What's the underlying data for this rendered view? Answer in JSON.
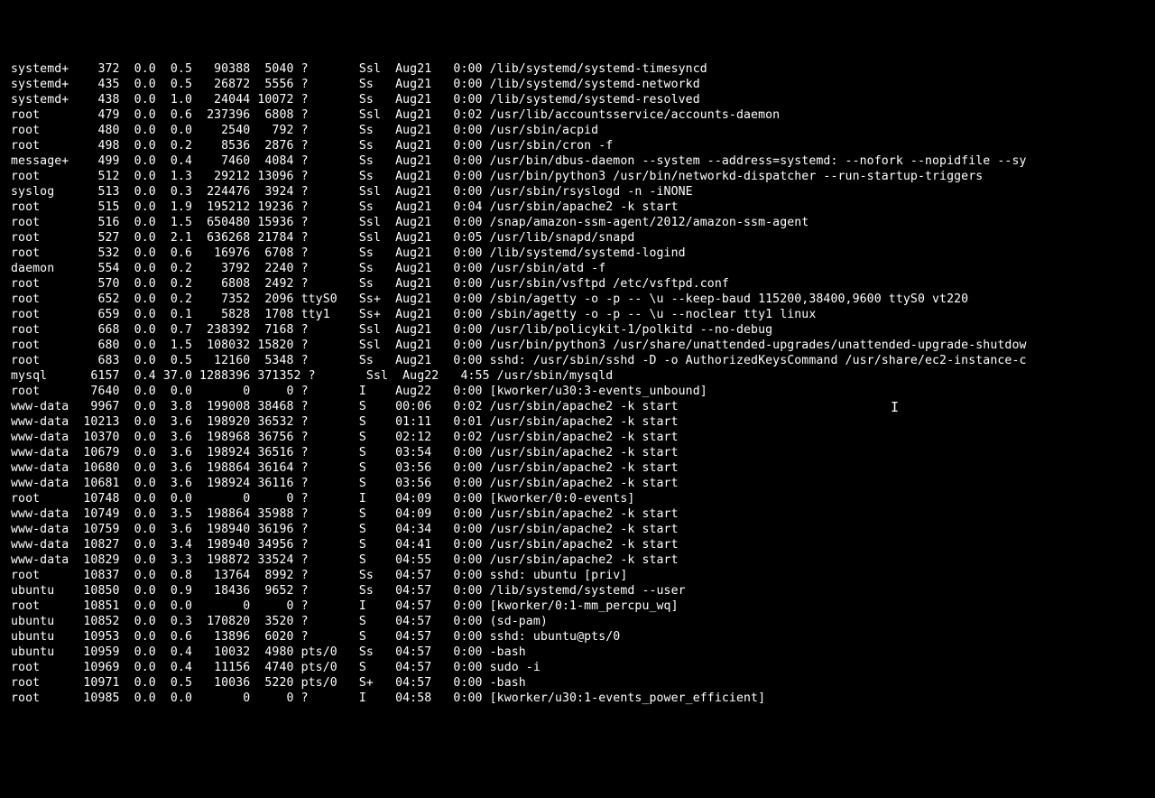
{
  "cursor_glyph": "I",
  "cols_pad": {
    "user": 9,
    "pid": 8,
    "cpu": 5,
    "mem": 5,
    "vsz": 7,
    "rss": 6,
    "tty": 6,
    "stat": 5,
    "start": 7,
    "time": 5
  },
  "rows": [
    {
      "user": "systemd+",
      "pid": "372",
      "cpu": "0.0",
      "mem": "0.5",
      "vsz": "90388",
      "rss": "5040",
      "tty": "?",
      "stat": "Ssl",
      "start": "Aug21",
      "time": "0:00",
      "cmd": "/lib/systemd/systemd-timesyncd"
    },
    {
      "user": "systemd+",
      "pid": "435",
      "cpu": "0.0",
      "mem": "0.5",
      "vsz": "26872",
      "rss": "5556",
      "tty": "?",
      "stat": "Ss",
      "start": "Aug21",
      "time": "0:00",
      "cmd": "/lib/systemd/systemd-networkd"
    },
    {
      "user": "systemd+",
      "pid": "438",
      "cpu": "0.0",
      "mem": "1.0",
      "vsz": "24044",
      "rss": "10072",
      "tty": "?",
      "stat": "Ss",
      "start": "Aug21",
      "time": "0:00",
      "cmd": "/lib/systemd/systemd-resolved"
    },
    {
      "user": "root",
      "pid": "479",
      "cpu": "0.0",
      "mem": "0.6",
      "vsz": "237396",
      "rss": "6808",
      "tty": "?",
      "stat": "Ssl",
      "start": "Aug21",
      "time": "0:02",
      "cmd": "/usr/lib/accountsservice/accounts-daemon"
    },
    {
      "user": "root",
      "pid": "480",
      "cpu": "0.0",
      "mem": "0.0",
      "vsz": "2540",
      "rss": "792",
      "tty": "?",
      "stat": "Ss",
      "start": "Aug21",
      "time": "0:00",
      "cmd": "/usr/sbin/acpid"
    },
    {
      "user": "root",
      "pid": "498",
      "cpu": "0.0",
      "mem": "0.2",
      "vsz": "8536",
      "rss": "2876",
      "tty": "?",
      "stat": "Ss",
      "start": "Aug21",
      "time": "0:00",
      "cmd": "/usr/sbin/cron -f"
    },
    {
      "user": "message+",
      "pid": "499",
      "cpu": "0.0",
      "mem": "0.4",
      "vsz": "7460",
      "rss": "4084",
      "tty": "?",
      "stat": "Ss",
      "start": "Aug21",
      "time": "0:00",
      "cmd": "/usr/bin/dbus-daemon --system --address=systemd: --nofork --nopidfile --sy"
    },
    {
      "user": "root",
      "pid": "512",
      "cpu": "0.0",
      "mem": "1.3",
      "vsz": "29212",
      "rss": "13096",
      "tty": "?",
      "stat": "Ss",
      "start": "Aug21",
      "time": "0:00",
      "cmd": "/usr/bin/python3 /usr/bin/networkd-dispatcher --run-startup-triggers"
    },
    {
      "user": "syslog",
      "pid": "513",
      "cpu": "0.0",
      "mem": "0.3",
      "vsz": "224476",
      "rss": "3924",
      "tty": "?",
      "stat": "Ssl",
      "start": "Aug21",
      "time": "0:00",
      "cmd": "/usr/sbin/rsyslogd -n -iNONE"
    },
    {
      "user": "root",
      "pid": "515",
      "cpu": "0.0",
      "mem": "1.9",
      "vsz": "195212",
      "rss": "19236",
      "tty": "?",
      "stat": "Ss",
      "start": "Aug21",
      "time": "0:04",
      "cmd": "/usr/sbin/apache2 -k start"
    },
    {
      "user": "root",
      "pid": "516",
      "cpu": "0.0",
      "mem": "1.5",
      "vsz": "650480",
      "rss": "15936",
      "tty": "?",
      "stat": "Ssl",
      "start": "Aug21",
      "time": "0:00",
      "cmd": "/snap/amazon-ssm-agent/2012/amazon-ssm-agent"
    },
    {
      "user": "root",
      "pid": "527",
      "cpu": "0.0",
      "mem": "2.1",
      "vsz": "636268",
      "rss": "21784",
      "tty": "?",
      "stat": "Ssl",
      "start": "Aug21",
      "time": "0:05",
      "cmd": "/usr/lib/snapd/snapd"
    },
    {
      "user": "root",
      "pid": "532",
      "cpu": "0.0",
      "mem": "0.6",
      "vsz": "16976",
      "rss": "6708",
      "tty": "?",
      "stat": "Ss",
      "start": "Aug21",
      "time": "0:00",
      "cmd": "/lib/systemd/systemd-logind"
    },
    {
      "user": "daemon",
      "pid": "554",
      "cpu": "0.0",
      "mem": "0.2",
      "vsz": "3792",
      "rss": "2240",
      "tty": "?",
      "stat": "Ss",
      "start": "Aug21",
      "time": "0:00",
      "cmd": "/usr/sbin/atd -f"
    },
    {
      "user": "root",
      "pid": "570",
      "cpu": "0.0",
      "mem": "0.2",
      "vsz": "6808",
      "rss": "2492",
      "tty": "?",
      "stat": "Ss",
      "start": "Aug21",
      "time": "0:00",
      "cmd": "/usr/sbin/vsftpd /etc/vsftpd.conf"
    },
    {
      "user": "root",
      "pid": "652",
      "cpu": "0.0",
      "mem": "0.2",
      "vsz": "7352",
      "rss": "2096",
      "tty": "ttyS0",
      "stat": "Ss+",
      "start": "Aug21",
      "time": "0:00",
      "cmd": "/sbin/agetty -o -p -- \\u --keep-baud 115200,38400,9600 ttyS0 vt220"
    },
    {
      "user": "root",
      "pid": "659",
      "cpu": "0.0",
      "mem": "0.1",
      "vsz": "5828",
      "rss": "1708",
      "tty": "tty1",
      "stat": "Ss+",
      "start": "Aug21",
      "time": "0:00",
      "cmd": "/sbin/agetty -o -p -- \\u --noclear tty1 linux"
    },
    {
      "user": "root",
      "pid": "668",
      "cpu": "0.0",
      "mem": "0.7",
      "vsz": "238392",
      "rss": "7168",
      "tty": "?",
      "stat": "Ssl",
      "start": "Aug21",
      "time": "0:00",
      "cmd": "/usr/lib/policykit-1/polkitd --no-debug"
    },
    {
      "user": "root",
      "pid": "680",
      "cpu": "0.0",
      "mem": "1.5",
      "vsz": "108032",
      "rss": "15820",
      "tty": "?",
      "stat": "Ssl",
      "start": "Aug21",
      "time": "0:00",
      "cmd": "/usr/bin/python3 /usr/share/unattended-upgrades/unattended-upgrade-shutdow"
    },
    {
      "user": "root",
      "pid": "683",
      "cpu": "0.0",
      "mem": "0.5",
      "vsz": "12160",
      "rss": "5348",
      "tty": "?",
      "stat": "Ss",
      "start": "Aug21",
      "time": "0:00",
      "cmd": "sshd: /usr/sbin/sshd -D -o AuthorizedKeysCommand /usr/share/ec2-instance-c"
    },
    {
      "user": "mysql",
      "pid": "6157",
      "cpu": "0.4",
      "mem": "37.0",
      "vsz": "1288396",
      "rss": "371352",
      "tty": "?",
      "stat": "Ssl",
      "start": "Aug22",
      "time": "4:55",
      "cmd": "/usr/sbin/mysqld"
    },
    {
      "user": "root",
      "pid": "7640",
      "cpu": "0.0",
      "mem": "0.0",
      "vsz": "0",
      "rss": "0",
      "tty": "?",
      "stat": "I",
      "start": "Aug22",
      "time": "0:00",
      "cmd": "[kworker/u30:3-events_unbound]"
    },
    {
      "user": "www-data",
      "pid": "9967",
      "cpu": "0.0",
      "mem": "3.8",
      "vsz": "199008",
      "rss": "38468",
      "tty": "?",
      "stat": "S",
      "start": "00:06",
      "time": "0:02",
      "cmd": "/usr/sbin/apache2 -k start"
    },
    {
      "user": "www-data",
      "pid": "10213",
      "cpu": "0.0",
      "mem": "3.6",
      "vsz": "198920",
      "rss": "36532",
      "tty": "?",
      "stat": "S",
      "start": "01:11",
      "time": "0:01",
      "cmd": "/usr/sbin/apache2 -k start"
    },
    {
      "user": "www-data",
      "pid": "10370",
      "cpu": "0.0",
      "mem": "3.6",
      "vsz": "198968",
      "rss": "36756",
      "tty": "?",
      "stat": "S",
      "start": "02:12",
      "time": "0:02",
      "cmd": "/usr/sbin/apache2 -k start"
    },
    {
      "user": "www-data",
      "pid": "10679",
      "cpu": "0.0",
      "mem": "3.6",
      "vsz": "198924",
      "rss": "36516",
      "tty": "?",
      "stat": "S",
      "start": "03:54",
      "time": "0:00",
      "cmd": "/usr/sbin/apache2 -k start"
    },
    {
      "user": "www-data",
      "pid": "10680",
      "cpu": "0.0",
      "mem": "3.6",
      "vsz": "198864",
      "rss": "36164",
      "tty": "?",
      "stat": "S",
      "start": "03:56",
      "time": "0:00",
      "cmd": "/usr/sbin/apache2 -k start"
    },
    {
      "user": "www-data",
      "pid": "10681",
      "cpu": "0.0",
      "mem": "3.6",
      "vsz": "198924",
      "rss": "36116",
      "tty": "?",
      "stat": "S",
      "start": "03:56",
      "time": "0:00",
      "cmd": "/usr/sbin/apache2 -k start"
    },
    {
      "user": "root",
      "pid": "10748",
      "cpu": "0.0",
      "mem": "0.0",
      "vsz": "0",
      "rss": "0",
      "tty": "?",
      "stat": "I",
      "start": "04:09",
      "time": "0:00",
      "cmd": "[kworker/0:0-events]"
    },
    {
      "user": "www-data",
      "pid": "10749",
      "cpu": "0.0",
      "mem": "3.5",
      "vsz": "198864",
      "rss": "35988",
      "tty": "?",
      "stat": "S",
      "start": "04:09",
      "time": "0:00",
      "cmd": "/usr/sbin/apache2 -k start"
    },
    {
      "user": "www-data",
      "pid": "10759",
      "cpu": "0.0",
      "mem": "3.6",
      "vsz": "198940",
      "rss": "36196",
      "tty": "?",
      "stat": "S",
      "start": "04:34",
      "time": "0:00",
      "cmd": "/usr/sbin/apache2 -k start"
    },
    {
      "user": "www-data",
      "pid": "10827",
      "cpu": "0.0",
      "mem": "3.4",
      "vsz": "198940",
      "rss": "34956",
      "tty": "?",
      "stat": "S",
      "start": "04:41",
      "time": "0:00",
      "cmd": "/usr/sbin/apache2 -k start"
    },
    {
      "user": "www-data",
      "pid": "10829",
      "cpu": "0.0",
      "mem": "3.3",
      "vsz": "198872",
      "rss": "33524",
      "tty": "?",
      "stat": "S",
      "start": "04:55",
      "time": "0:00",
      "cmd": "/usr/sbin/apache2 -k start"
    },
    {
      "user": "root",
      "pid": "10837",
      "cpu": "0.0",
      "mem": "0.8",
      "vsz": "13764",
      "rss": "8992",
      "tty": "?",
      "stat": "Ss",
      "start": "04:57",
      "time": "0:00",
      "cmd": "sshd: ubuntu [priv]"
    },
    {
      "user": "ubuntu",
      "pid": "10850",
      "cpu": "0.0",
      "mem": "0.9",
      "vsz": "18436",
      "rss": "9652",
      "tty": "?",
      "stat": "Ss",
      "start": "04:57",
      "time": "0:00",
      "cmd": "/lib/systemd/systemd --user"
    },
    {
      "user": "root",
      "pid": "10851",
      "cpu": "0.0",
      "mem": "0.0",
      "vsz": "0",
      "rss": "0",
      "tty": "?",
      "stat": "I",
      "start": "04:57",
      "time": "0:00",
      "cmd": "[kworker/0:1-mm_percpu_wq]"
    },
    {
      "user": "ubuntu",
      "pid": "10852",
      "cpu": "0.0",
      "mem": "0.3",
      "vsz": "170820",
      "rss": "3520",
      "tty": "?",
      "stat": "S",
      "start": "04:57",
      "time": "0:00",
      "cmd": "(sd-pam)"
    },
    {
      "user": "ubuntu",
      "pid": "10953",
      "cpu": "0.0",
      "mem": "0.6",
      "vsz": "13896",
      "rss": "6020",
      "tty": "?",
      "stat": "S",
      "start": "04:57",
      "time": "0:00",
      "cmd": "sshd: ubuntu@pts/0"
    },
    {
      "user": "ubuntu",
      "pid": "10959",
      "cpu": "0.0",
      "mem": "0.4",
      "vsz": "10032",
      "rss": "4980",
      "tty": "pts/0",
      "stat": "Ss",
      "start": "04:57",
      "time": "0:00",
      "cmd": "-bash"
    },
    {
      "user": "root",
      "pid": "10969",
      "cpu": "0.0",
      "mem": "0.4",
      "vsz": "11156",
      "rss": "4740",
      "tty": "pts/0",
      "stat": "S",
      "start": "04:57",
      "time": "0:00",
      "cmd": "sudo -i"
    },
    {
      "user": "root",
      "pid": "10971",
      "cpu": "0.0",
      "mem": "0.5",
      "vsz": "10036",
      "rss": "5220",
      "tty": "pts/0",
      "stat": "S+",
      "start": "04:57",
      "time": "0:00",
      "cmd": "-bash"
    },
    {
      "user": "root",
      "pid": "10985",
      "cpu": "0.0",
      "mem": "0.0",
      "vsz": "0",
      "rss": "0",
      "tty": "?",
      "stat": "I",
      "start": "04:58",
      "time": "0:00",
      "cmd": "[kworker/u30:1-events_power_efficient]"
    }
  ]
}
